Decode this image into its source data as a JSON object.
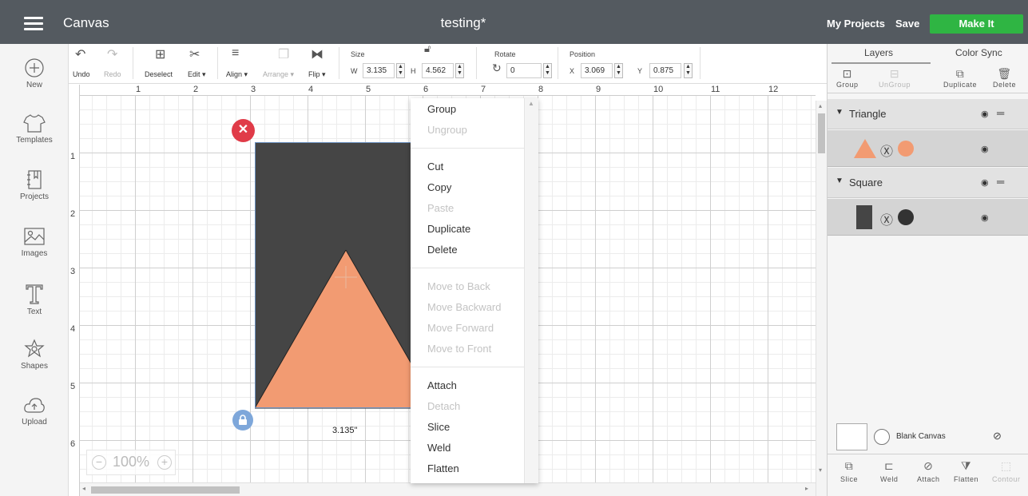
{
  "topbar": {
    "app_title": "Canvas",
    "doc_title": "testing*",
    "my_projects": "My Projects",
    "save": "Save",
    "make_it": "Make It"
  },
  "leftnav": {
    "new": "New",
    "templates": "Templates",
    "projects": "Projects",
    "images": "Images",
    "text": "Text",
    "shapes": "Shapes",
    "upload": "Upload"
  },
  "toolbar": {
    "undo": "Undo",
    "redo": "Redo",
    "deselect": "Deselect",
    "edit": "Edit ▾",
    "align": "Align ▾",
    "arrange": "Arrange ▾",
    "flip": "Flip ▾",
    "size_label": "Size",
    "w_label": "W",
    "w_value": "3.135",
    "h_label": "H",
    "h_value": "4.562",
    "rotate_label": "Rotate",
    "rotate_value": "0",
    "position_label": "Position",
    "x_label": "X",
    "x_value": "3.069",
    "y_label": "Y",
    "y_value": "0.875"
  },
  "ruler": {
    "top": [
      "1",
      "2",
      "3",
      "4",
      "5",
      "6",
      "7",
      "8",
      "9",
      "10",
      "11",
      "12"
    ],
    "left": [
      "1",
      "2",
      "3",
      "4",
      "5",
      "6"
    ]
  },
  "canvas": {
    "width_label": "3.135\"",
    "zoom": "100%",
    "square_color": "#454545",
    "triangle_color": "#f29b72"
  },
  "context_menu": {
    "group": "Group",
    "ungroup": "Ungroup",
    "cut": "Cut",
    "copy": "Copy",
    "paste": "Paste",
    "duplicate": "Duplicate",
    "delete": "Delete",
    "move_back": "Move to Back",
    "move_backward": "Move Backward",
    "move_forward": "Move Forward",
    "move_front": "Move to Front",
    "attach": "Attach",
    "detach": "Detach",
    "slice": "Slice",
    "weld": "Weld",
    "flatten": "Flatten"
  },
  "right_panel": {
    "tab_layers": "Layers",
    "tab_color_sync": "Color Sync",
    "group": "Group",
    "ungroup": "UnGroup",
    "duplicate": "Duplicate",
    "delete": "Delete",
    "layer1": "Triangle",
    "layer2": "Square",
    "blank_canvas": "Blank Canvas",
    "slice": "Slice",
    "weld": "Weld",
    "attach": "Attach",
    "flatten": "Flatten",
    "contour": "Contour"
  }
}
